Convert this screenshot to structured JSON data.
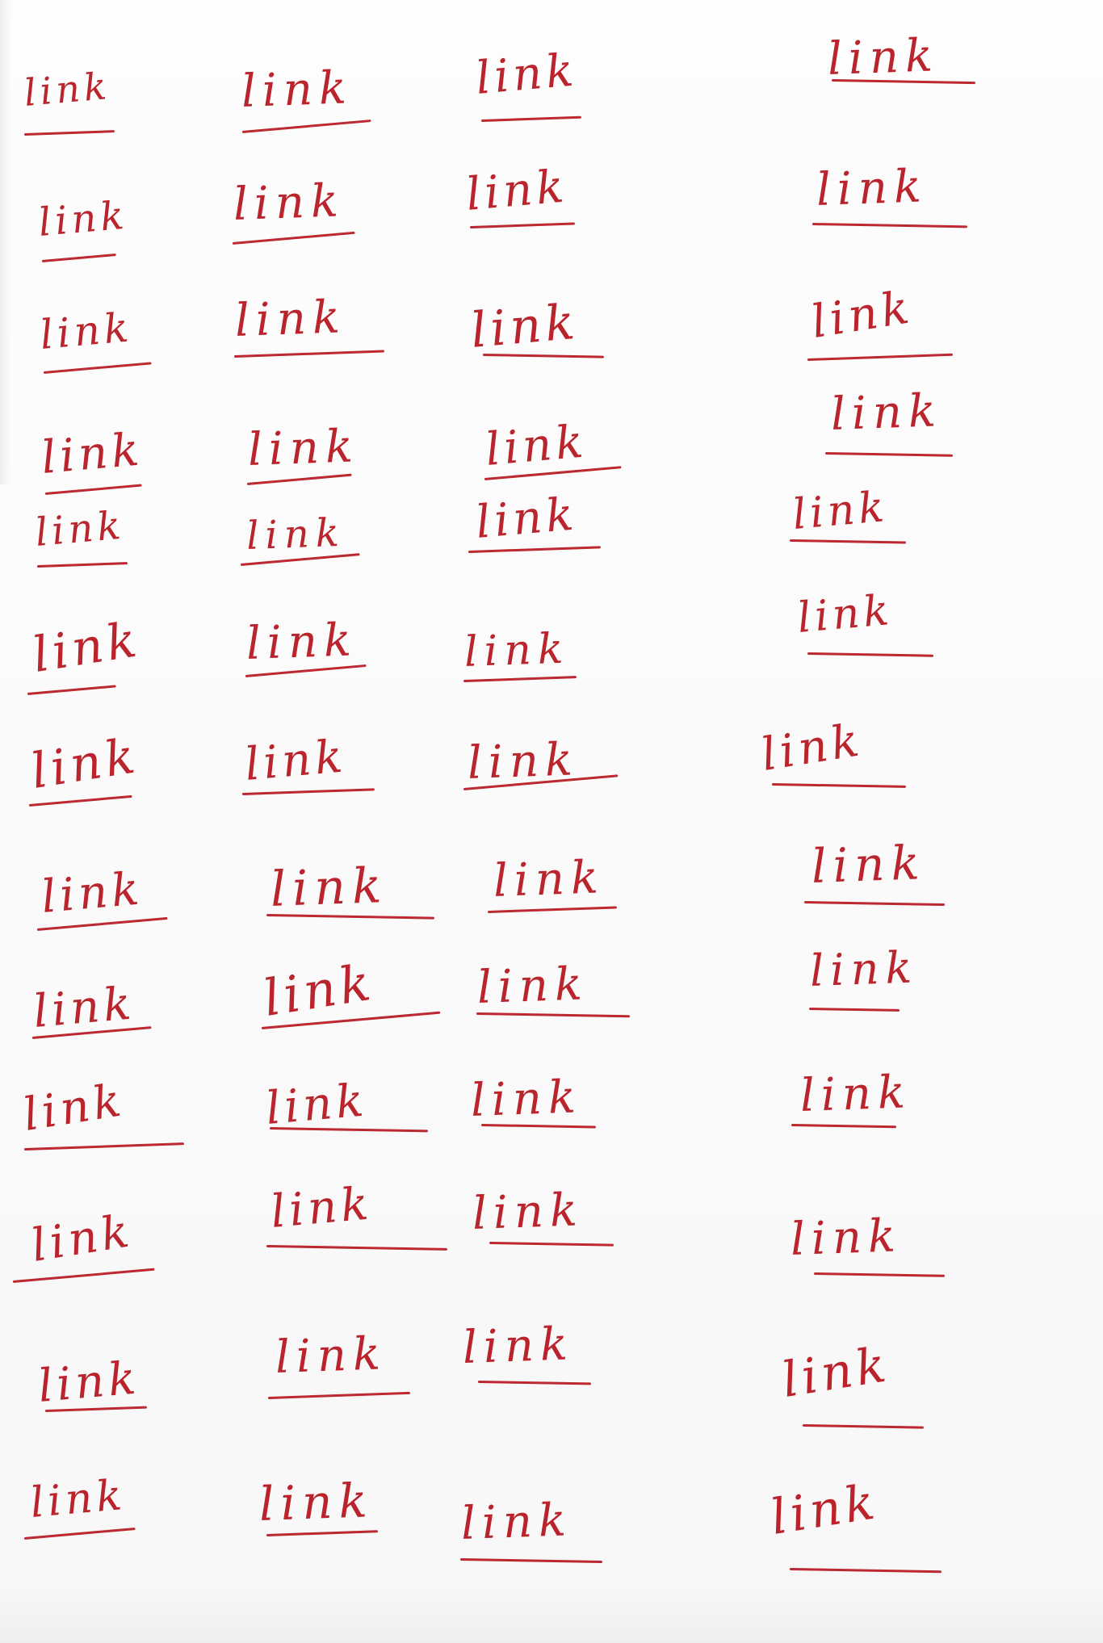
{
  "sheet": {
    "ink_color": "#b5121b",
    "paper_color": "#fbfbfb",
    "rows": [
      [
        "link",
        "link",
        "link",
        "link"
      ],
      [
        "link",
        "link",
        "link",
        "link"
      ],
      [
        "link",
        "link",
        "link",
        "link"
      ],
      [
        "link",
        "link",
        "link",
        "link"
      ],
      [
        "link",
        "link",
        "link",
        "link"
      ],
      [
        "link",
        "link",
        "link",
        "link"
      ],
      [
        "link",
        "link",
        "link",
        "link"
      ],
      [
        "link",
        "link",
        "link",
        "link"
      ],
      [
        "link",
        "link",
        "link",
        "link"
      ],
      [
        "link",
        "link",
        "link",
        "link"
      ],
      [
        "link",
        "link",
        "link",
        "link"
      ],
      [
        "link",
        "link",
        "link",
        "link"
      ],
      [
        "link",
        "link",
        "link",
        "link"
      ]
    ]
  }
}
